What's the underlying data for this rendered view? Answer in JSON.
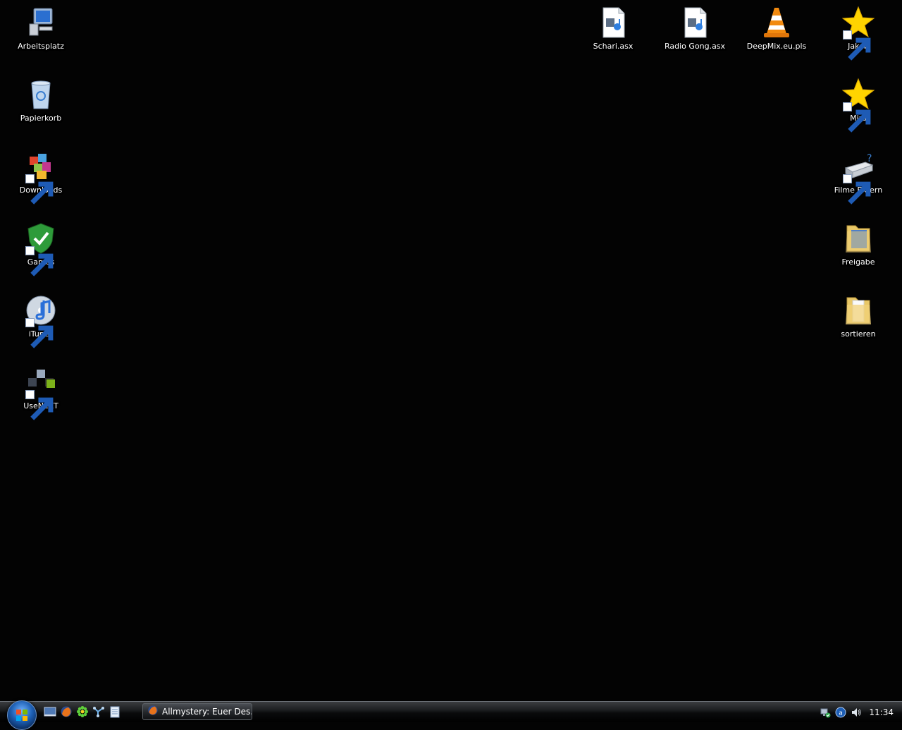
{
  "desktop": {
    "left_icons": [
      {
        "label": "Arbeitsplatz",
        "icon": "computer-icon"
      },
      {
        "label": "Papierkorb",
        "icon": "recycle-bin-icon"
      },
      {
        "label": "Downloads",
        "icon": "downloads-app-icon"
      },
      {
        "label": "Games",
        "icon": "games-shield-icon"
      },
      {
        "label": "iTunes",
        "icon": "itunes-icon"
      },
      {
        "label": "UseNeXT",
        "icon": "usenext-icon"
      }
    ],
    "top_icons": [
      {
        "label": "Schari.asx",
        "icon": "media-file-icon"
      },
      {
        "label": "Radio Gong.asx",
        "icon": "media-file-icon"
      },
      {
        "label": "DeepMix.eu.pls",
        "icon": "vlc-cone-icon"
      },
      {
        "label": "Jakob",
        "icon": "star-icon"
      }
    ],
    "right_icons": [
      {
        "label": "Mira",
        "icon": "star-icon"
      },
      {
        "label": "Filme Extern",
        "icon": "external-drive-icon"
      },
      {
        "label": "Freigabe",
        "icon": "folder-icon"
      },
      {
        "label": "sortieren",
        "icon": "folder-icon"
      }
    ]
  },
  "taskbar": {
    "start_icon": "windows-start-orb-icon",
    "quick_launch": [
      "show-desktop-icon",
      "firefox-icon",
      "icq-flower-icon",
      "network-icon",
      "notepad-icon"
    ],
    "tasks": [
      {
        "label": "Allmystery: Euer Des...",
        "icon": "firefox-icon"
      }
    ],
    "tray": {
      "icons": [
        "network-status-icon",
        "antivirus-icon",
        "volume-icon"
      ],
      "clock": "11:34"
    }
  },
  "colors": {
    "background": "#030303",
    "text": "#ffffff",
    "star": "#ffd400",
    "folder": "#f2d27a"
  }
}
